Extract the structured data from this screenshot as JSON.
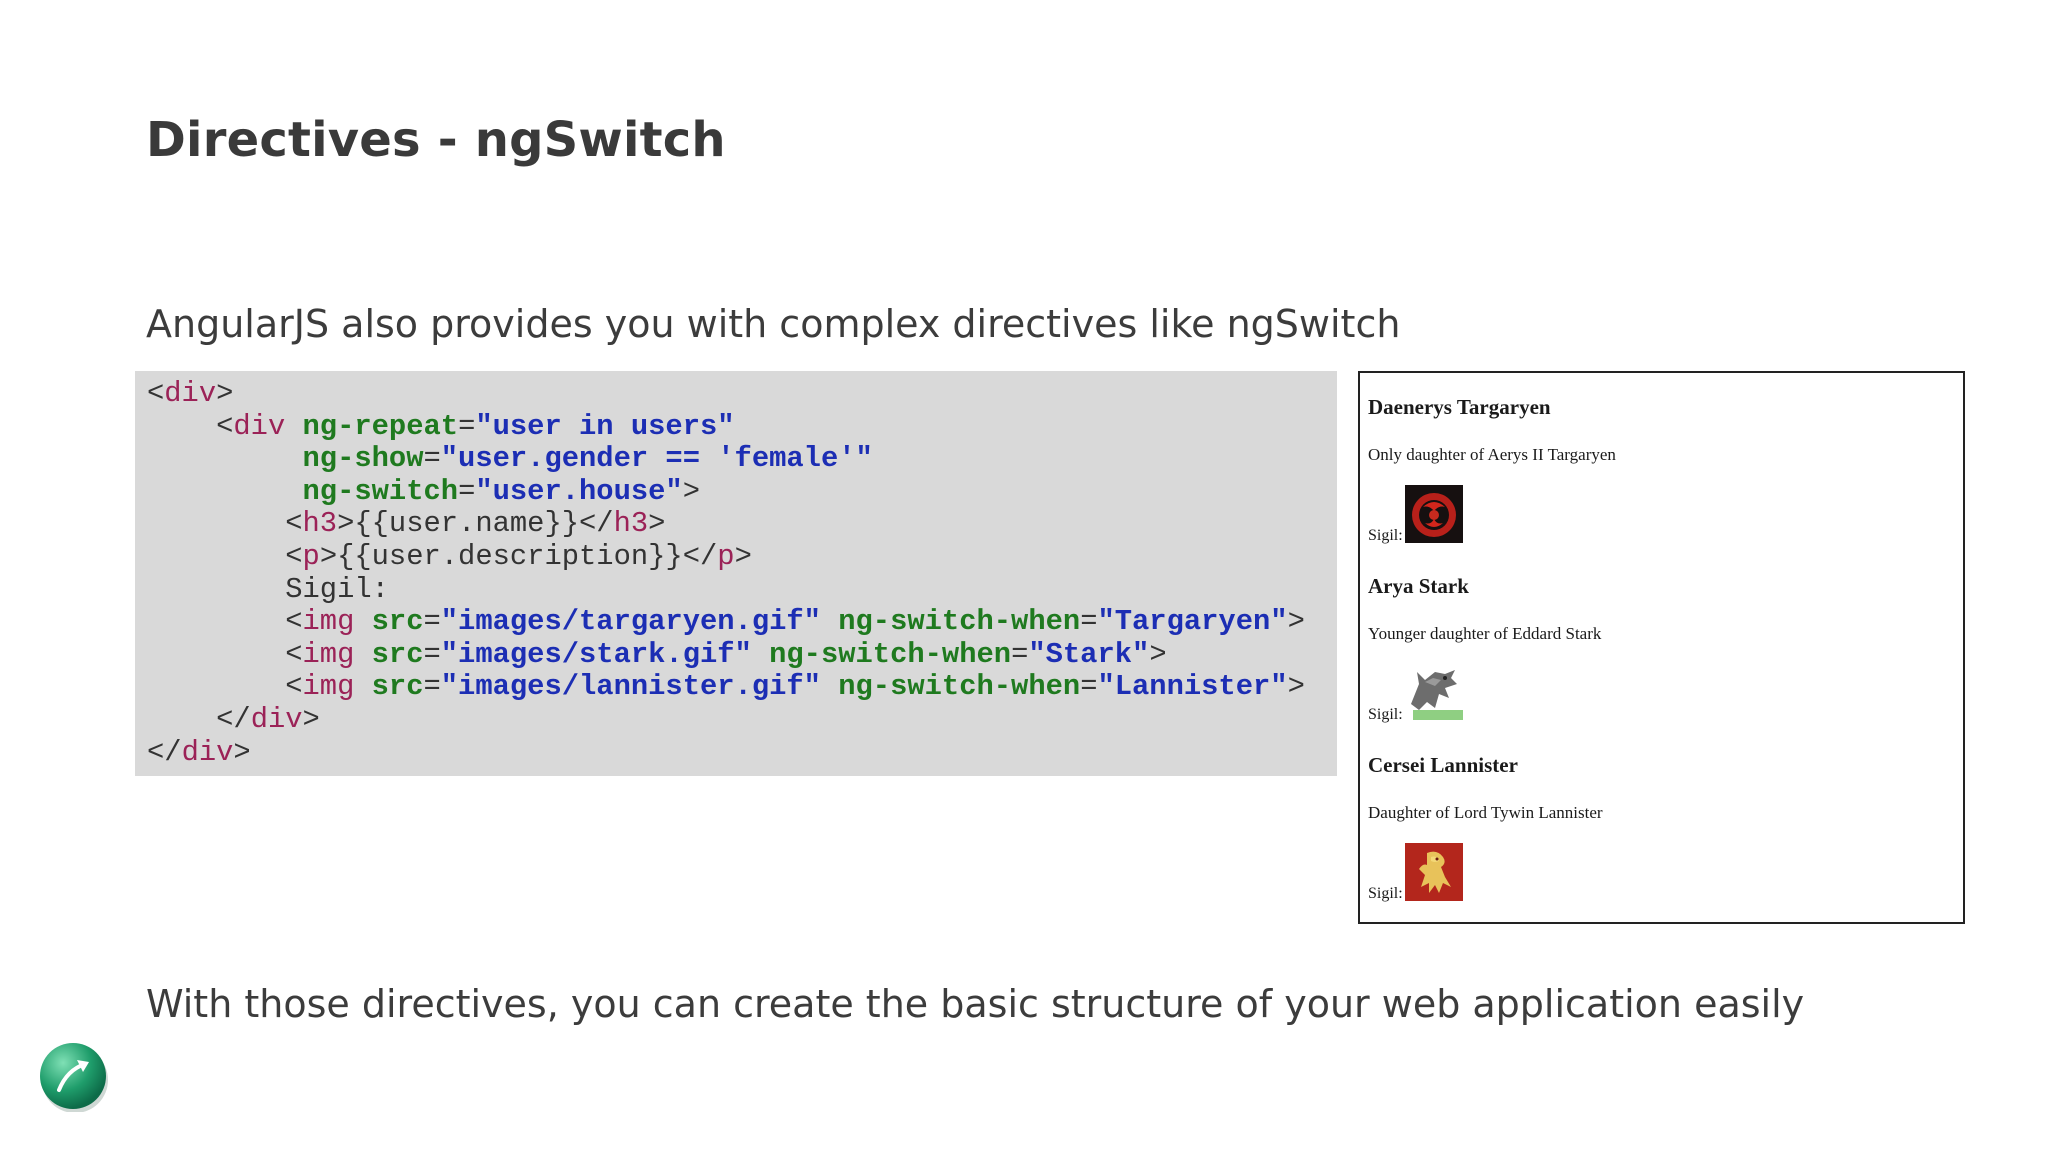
{
  "slide": {
    "title": "Directives - ngSwitch",
    "intro": "AngularJS also provides you with complex directives like ngSwitch",
    "outro": "With those directives, you can create the basic structure of your web application easily"
  },
  "code_snippet": {
    "l1_tag": "div",
    "l2_tag": "div",
    "l2_attr": "ng-repeat",
    "l2_val": "\"user in users\"",
    "l3_attr": "ng-show",
    "l3_val": "\"user.gender == 'female'\"",
    "l4_attr": "ng-switch",
    "l4_val": "\"user.house\"",
    "l5_tag": "h3",
    "l5_text": "{{user.name}}",
    "l6_tag": "p",
    "l6_text": "{{user.description}}",
    "l7_text": "Sigil:",
    "img_tag": "img",
    "src_attr": "src",
    "switch_when_attr": "ng-switch-when",
    "l8_src": "\"images/targaryen.gif\"",
    "l8_when": "\"Targaryen\"",
    "l9_src": "\"images/stark.gif\"",
    "l9_when": "\"Stark\"",
    "l10_src": "\"images/lannister.gif\"",
    "l10_when": "\"Lannister\"",
    "l11_tag": "div",
    "l12_tag": "div"
  },
  "demo": {
    "users": [
      {
        "name": "Daenerys Targaryen",
        "description": "Only daughter of Aerys II Targaryen",
        "sigil_label": "Sigil:",
        "sigil_icon": "targaryen-dragon-sigil"
      },
      {
        "name": "Arya Stark",
        "description": "Younger daughter of Eddard Stark",
        "sigil_label": "Sigil:",
        "sigil_icon": "stark-direwolf-sigil"
      },
      {
        "name": "Cersei Lannister",
        "description": "Daughter of Lord Tywin Lannister",
        "sigil_label": "Sigil:",
        "sigil_icon": "lannister-lion-sigil"
      }
    ]
  },
  "colors": {
    "code_background": "#d9d9d9",
    "code_tag": "#9b2257",
    "code_attribute": "#1f7a1f",
    "code_value": "#1c2eb4",
    "logo_green": "#1f9d6b"
  },
  "logo_icon": "presentation-logo-icon"
}
